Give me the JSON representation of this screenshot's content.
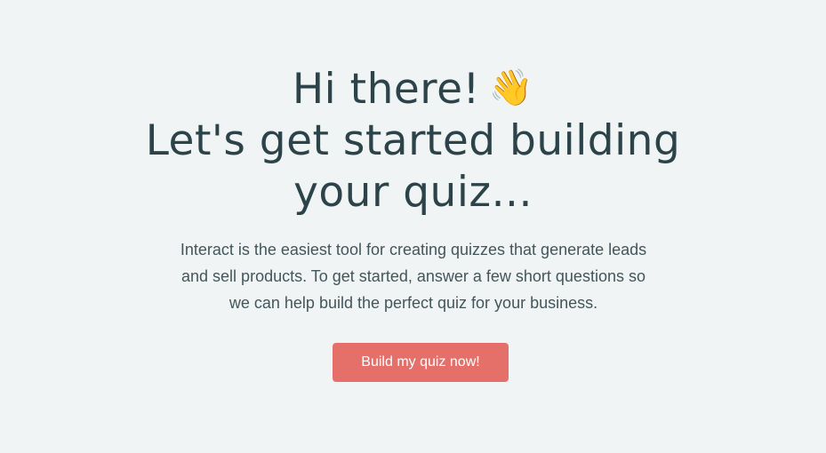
{
  "welcome": {
    "headline": {
      "line1": "Hi there!",
      "line1_emoji": "👋",
      "line2": "Let's get started building",
      "line3": "your quiz..."
    },
    "description": {
      "line1": "Interact is the easiest tool for creating quizzes that generate leads",
      "line2": "and sell products. To get started, answer a few short questions so",
      "line3": "we can help build the perfect quiz for your business."
    },
    "cta_label": "Build my quiz now!",
    "colors": {
      "background": "#f0f4f5",
      "heading_text": "#2b4349",
      "body_text": "#43565b",
      "cta_background": "#e5706a",
      "cta_text": "#ffffff"
    }
  }
}
